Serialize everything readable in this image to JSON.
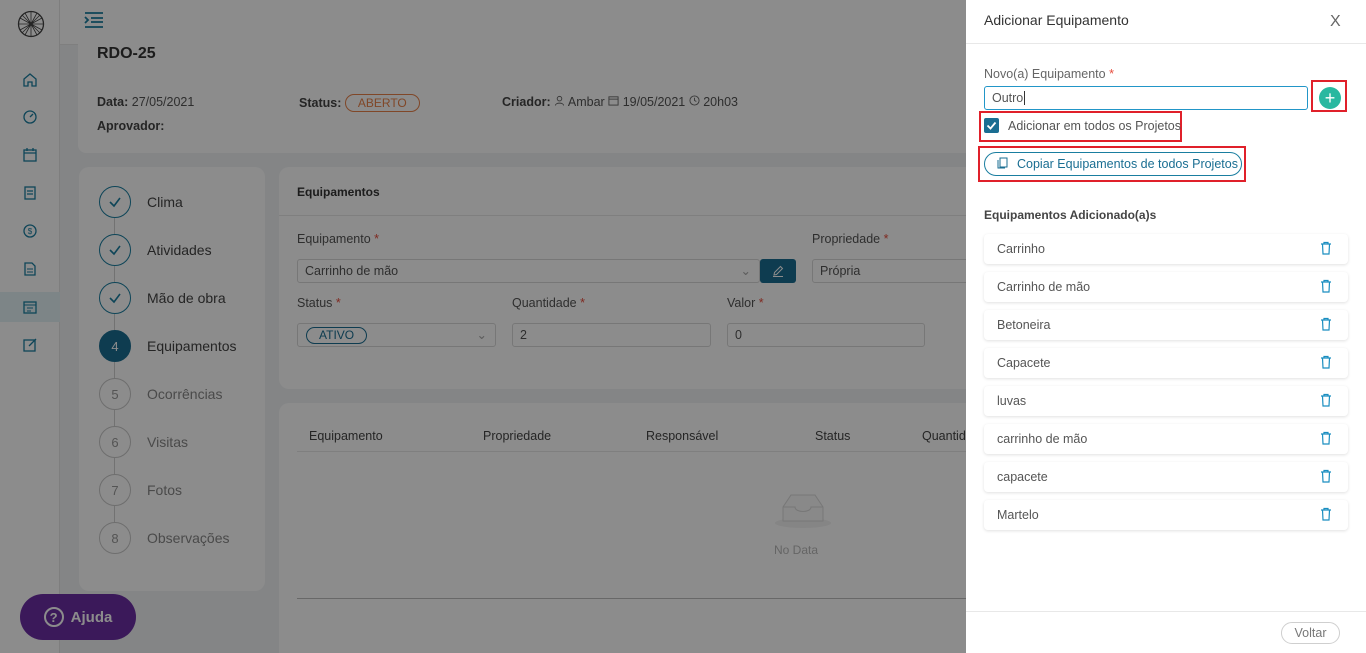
{
  "page": {
    "rdo_title": "RDO-25",
    "data_label": "Data:",
    "data_value": "27/05/2021",
    "status_label": "Status:",
    "status_value": "ABERTO",
    "criador_label": "Criador:",
    "criador_value": "Ambar",
    "criador_date": "19/05/2021",
    "criador_time": "20h03",
    "aprovador_label": "Aprovador:"
  },
  "steps": [
    {
      "number": "1",
      "label": "Clima",
      "state": "done"
    },
    {
      "number": "2",
      "label": "Atividades",
      "state": "done"
    },
    {
      "number": "3",
      "label": "Mão de obra",
      "state": "done"
    },
    {
      "number": "4",
      "label": "Equipamentos",
      "state": "current"
    },
    {
      "number": "5",
      "label": "Ocorrências",
      "state": "todo"
    },
    {
      "number": "6",
      "label": "Visitas",
      "state": "todo"
    },
    {
      "number": "7",
      "label": "Fotos",
      "state": "todo"
    },
    {
      "number": "8",
      "label": "Observações",
      "state": "todo"
    }
  ],
  "form": {
    "header": "Equipamentos",
    "equipamento_label": "Equipamento",
    "equipamento_value": "Carrinho de mão",
    "propriedade_label": "Propriedade",
    "propriedade_value": "Própria",
    "status_label": "Status",
    "status_value": "ATIVO",
    "quantidade_label": "Quantidade",
    "quantidade_value": "2",
    "valor_label": "Valor",
    "valor_value": "0",
    "required_mark": "*"
  },
  "table": {
    "columns": [
      "Equipamento",
      "Propriedade",
      "Responsável",
      "Status",
      "Quantid"
    ],
    "empty_text": "No Data"
  },
  "help": {
    "label": "Ajuda"
  },
  "drawer": {
    "title": "Adicionar Equipamento",
    "close_label": "X",
    "new_label": "Novo(a) Equipamento",
    "new_value": "Outro",
    "checkbox_label": "Adicionar em todos os Projetos",
    "checkbox_checked": true,
    "copy_button": "Copiar Equipamentos de todos Projetos",
    "added_title": "Equipamentos Adicionado(a)s",
    "items": [
      "Carrinho",
      "Carrinho de mão",
      "Betoneira",
      "Capacete",
      "luvas",
      "carrinho de mão",
      "capacete",
      "Martelo"
    ],
    "back_button": "Voltar"
  },
  "colors": {
    "primary": "#1a6e92",
    "accent_green": "#28b8a0",
    "help_purple": "#6c2ea4",
    "status_orange": "#e9824a",
    "highlight_red": "#e0202a"
  }
}
